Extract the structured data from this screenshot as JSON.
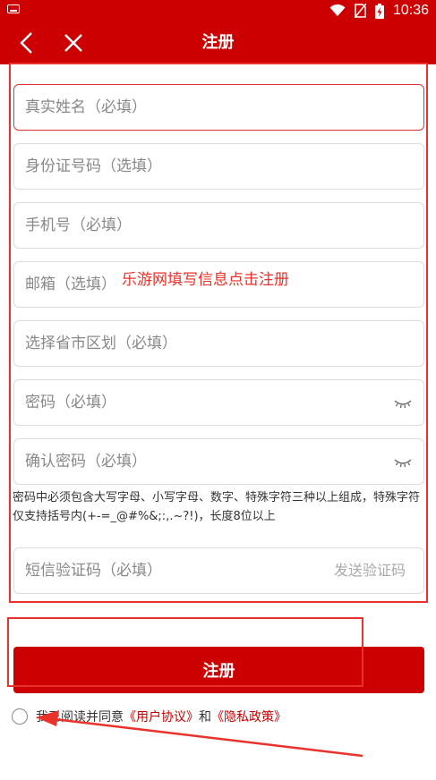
{
  "status_bar": {
    "time": "10:36"
  },
  "header": {
    "title": "注册",
    "back_icon": "chevron-left-icon",
    "close_icon": "close-icon"
  },
  "form": {
    "real_name_placeholder": "真实姓名（必填）",
    "id_number_placeholder": "身份证号码（选填）",
    "phone_placeholder": "手机号（必填）",
    "email_placeholder": "邮箱（选填）",
    "region_placeholder": "选择省市区划（必填）",
    "password_placeholder": "密码（必填）",
    "confirm_password_placeholder": "确认密码（必填）",
    "password_hint": "密码中必须包含大写字母、小写字母、数字、特殊字符三种以上组成，特殊字符仅支持括号内(+-=_@#%&;:,.~?!)，长度8位以上",
    "sms_code_placeholder": "短信验证码（必填）",
    "send_code_label": "发送验证码"
  },
  "register_button_label": "注册",
  "agreement": {
    "prefix": "我已阅读并同意",
    "user_agreement": "《用户协议》",
    "conjunction": "和",
    "privacy_policy": "《隐私政策》"
  },
  "annotation": {
    "note": "乐游网填写信息点击注册"
  },
  "colors": {
    "brand_red": "#cc0000",
    "annotation_red": "#e8322a"
  }
}
